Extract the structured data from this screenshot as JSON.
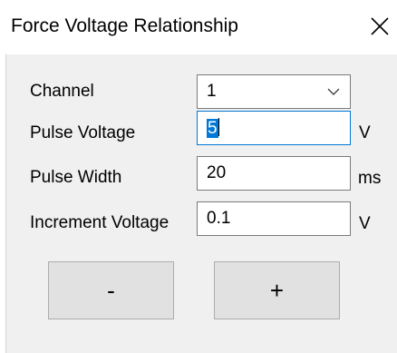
{
  "window": {
    "title": "Force Voltage Relationship",
    "close_icon": "close-icon"
  },
  "form": {
    "channel": {
      "label": "Channel",
      "value": "1"
    },
    "pulse_voltage": {
      "label": "Pulse Voltage",
      "value": "5",
      "unit": "V"
    },
    "pulse_width": {
      "label": "Pulse Width",
      "value": "20",
      "unit": "ms"
    },
    "increment_voltage": {
      "label": "Increment Voltage",
      "value": "0.1",
      "unit": "V"
    }
  },
  "buttons": {
    "minus_label": "-",
    "plus_label": "+"
  },
  "colors": {
    "selection": "#0078d7",
    "client_background": "#f0f0f0",
    "button_face": "#e1e1e1"
  }
}
